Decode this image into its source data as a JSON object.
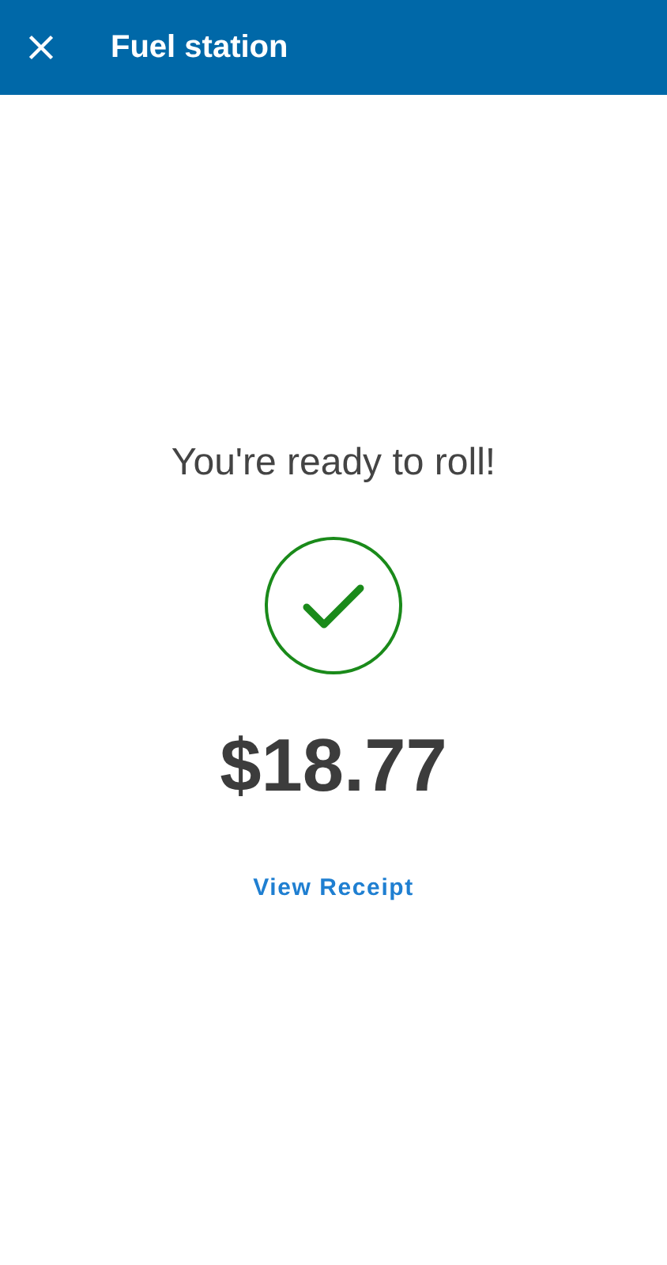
{
  "app_bar": {
    "title": "Fuel station"
  },
  "message": "You're ready to roll!",
  "status": {
    "kind": "success"
  },
  "amount": "$18.77",
  "receipt_link": "View Receipt"
}
